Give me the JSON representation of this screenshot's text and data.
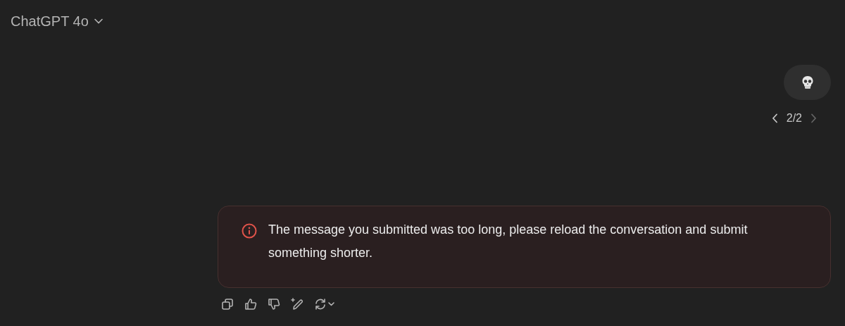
{
  "header": {
    "model": "ChatGPT 4o"
  },
  "user_message": {
    "kind": "emoji_skull"
  },
  "pager": {
    "text": "2/2",
    "prev_disabled": false,
    "next_disabled": true
  },
  "error": {
    "text": "The message you submitted was too long, please reload the conversation and submit something shorter."
  },
  "actions": [
    {
      "kind": "copy"
    },
    {
      "kind": "thumbs_up"
    },
    {
      "kind": "thumbs_down"
    },
    {
      "kind": "edit"
    },
    {
      "kind": "regenerate"
    }
  ]
}
